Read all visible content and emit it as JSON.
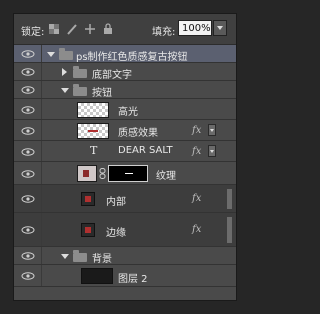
{
  "lockbar": {
    "lock_label": "锁定:",
    "fill_label": "填充:",
    "fill_value": "100%"
  },
  "layers": {
    "group_root": "ps制作红色质感复古按钮",
    "group_bottom": "底部文字",
    "group_button": "按钮",
    "highlight": "高光",
    "texture_effect": "质感效果",
    "dear_salt": "DEAR SALT",
    "texture": "纹理",
    "inner": "内部",
    "edge": "边缘",
    "group_bg": "背景",
    "layer2": "图层 2"
  },
  "fx_label": "fx",
  "text_layer_glyph": "T",
  "colors": {
    "panel_bg": "#4a4a4a",
    "selected_row": "#5b6070",
    "accent_red": "#b03030"
  }
}
